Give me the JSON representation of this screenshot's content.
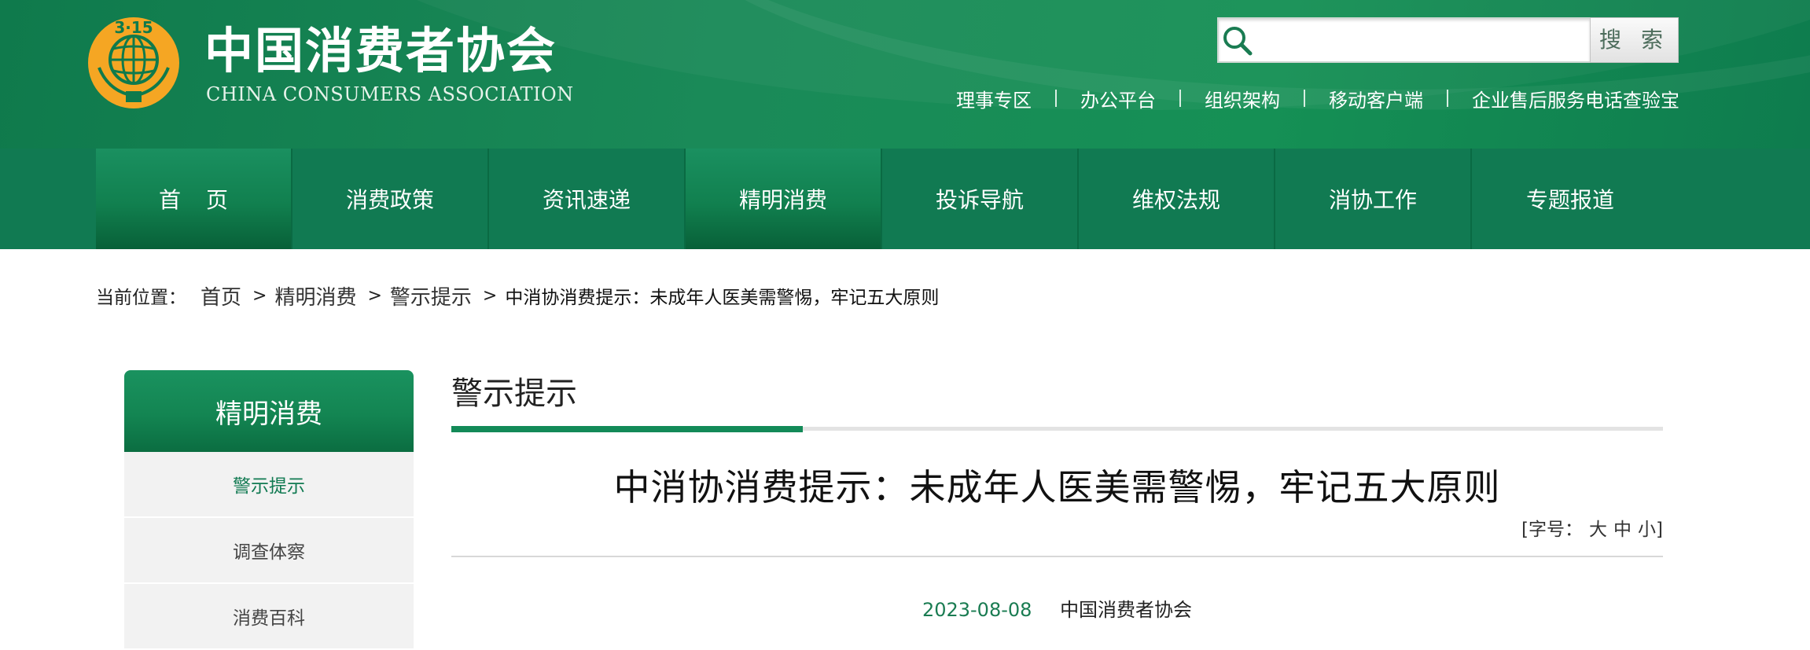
{
  "header": {
    "logo_badge": "3·15",
    "org_name_cn": "中国消费者协会",
    "org_name_en": "CHINA CONSUMERS ASSOCIATION",
    "search": {
      "placeholder": "",
      "value": "",
      "button_label": "搜 索"
    },
    "top_links": [
      "理事专区",
      "办公平台",
      "组织架构",
      "移动客户端",
      "企业售后服务电话查验宝"
    ]
  },
  "nav": {
    "items": [
      {
        "label": "首页",
        "active": true
      },
      {
        "label": "消费政策",
        "active": false
      },
      {
        "label": "资讯速递",
        "active": false
      },
      {
        "label": "精明消费",
        "active": true
      },
      {
        "label": "投诉导航",
        "active": false
      },
      {
        "label": "维权法规",
        "active": false
      },
      {
        "label": "消协工作",
        "active": false
      },
      {
        "label": "专题报道",
        "active": false
      }
    ]
  },
  "breadcrumb": {
    "label": "当前位置：",
    "items": [
      "首页",
      "精明消费",
      "警示提示"
    ],
    "separator": ">",
    "current": "中消协消费提示：未成年人医美需警惕，牢记五大原则"
  },
  "sidebar": {
    "title": "精明消费",
    "items": [
      {
        "label": "警示提示",
        "active": true
      },
      {
        "label": "调查体察",
        "active": false
      },
      {
        "label": "消费百科",
        "active": false
      }
    ]
  },
  "content": {
    "section_title": "警示提示",
    "article_title": "中消协消费提示：未成年人医美需警惕，牢记五大原则",
    "font_size_control": {
      "open": "[",
      "label": "字号：",
      "options": [
        "大",
        "中",
        "小"
      ],
      "close": "]"
    },
    "date": "2023-08-08",
    "source": "中国消费者协会"
  },
  "colors": {
    "brand_green": "#117a52",
    "logo_gold": "#f5a623",
    "accent_green_text": "#1a7c52"
  },
  "icons": {
    "logo": "globe-emblem-icon",
    "search": "magnifier-icon"
  }
}
